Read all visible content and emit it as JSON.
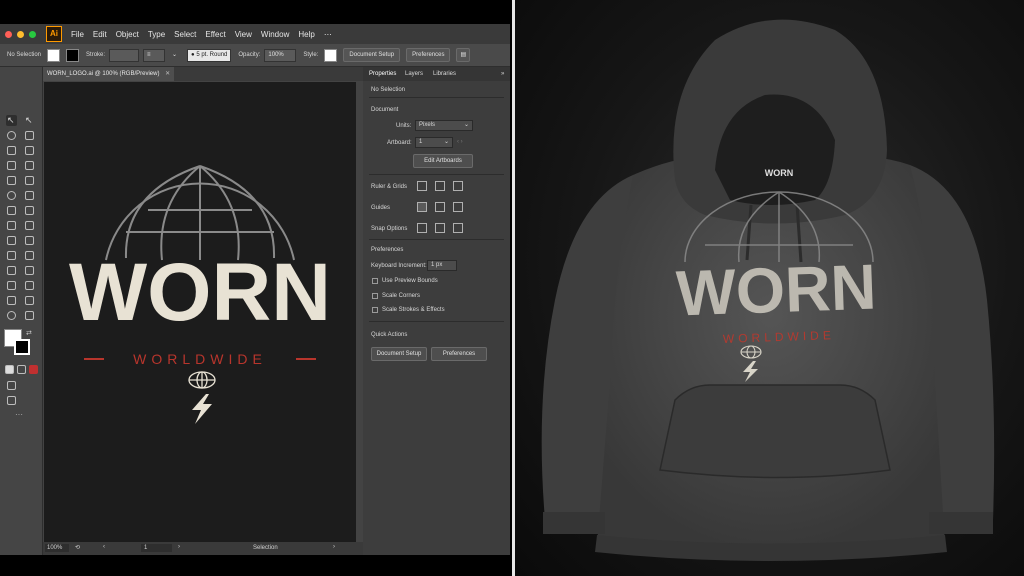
{
  "menubar": {
    "app_icon": "Ai",
    "items": [
      "File",
      "Edit",
      "Object",
      "Type",
      "Select",
      "Effect",
      "View",
      "Window",
      "Help"
    ]
  },
  "control_bar": {
    "selection": "No Selection",
    "stroke_label": "Stroke:",
    "brush": "5 pt. Round",
    "opacity_label": "Opacity:",
    "opacity_value": "100%",
    "style_label": "Style:",
    "document_setup": "Document Setup",
    "preferences": "Preferences"
  },
  "document": {
    "tab_title": "WORN_LOGO.ai @ 100% (RGB/Preview)"
  },
  "status_bar": {
    "zoom": "100%",
    "artboard": "1",
    "mode": "Selection"
  },
  "panel": {
    "tabs": [
      "Properties",
      "Layers",
      "Libraries"
    ],
    "no_selection": "No Selection",
    "document_heading": "Document",
    "units_label": "Units:",
    "units_value": "Pixels",
    "artboard_label": "Artboard:",
    "artboard_value": "1",
    "edit_artboards": "Edit Artboards",
    "ruler_grids": "Ruler & Grids",
    "guides": "Guides",
    "snap_options": "Snap Options",
    "preferences_heading": "Preferences",
    "keyboard_increment_label": "Keyboard Increment:",
    "keyboard_increment_value": "1 px",
    "use_preview_bounds": "Use Preview Bounds",
    "scale_corners": "Scale Corners",
    "scale_strokes": "Scale Strokes & Effects",
    "quick_actions": "Quick Actions",
    "qa_document_setup": "Document Setup",
    "qa_preferences": "Preferences"
  },
  "logo": {
    "main_text": "WORN",
    "sub_text": "WORLDWIDE"
  },
  "hoodie": {
    "neck_label": "WORN",
    "main_text": "WORN",
    "sub_text": "WORLDWIDE"
  },
  "colors": {
    "logo_cream": "#e8e2d4",
    "logo_red": "#b8352c",
    "artboard_bg": "#1c1c1c",
    "hoodie_gray": "#4a4a4a"
  }
}
